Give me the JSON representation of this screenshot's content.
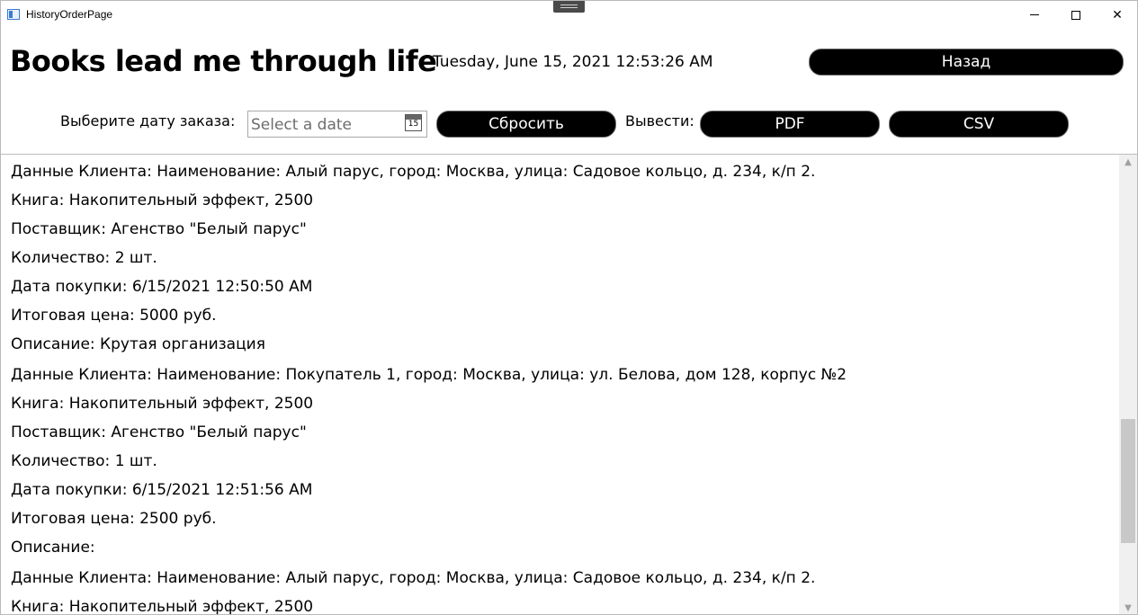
{
  "window": {
    "title": "HistoryOrderPage",
    "minimize_glyph": "",
    "close_glyph": "✕"
  },
  "header": {
    "brand": "Books lead me through life",
    "datetime": "Tuesday, June 15, 2021 12:53:26 AM",
    "back_label": "Назад"
  },
  "filter": {
    "date_label": "Выберите дату заказа:",
    "date_placeholder": "Select a date",
    "calendar_day": "15",
    "reset_label": "Сбросить",
    "export_label": "Вывести:",
    "pdf_label": "PDF",
    "csv_label": "CSV"
  },
  "orders": [
    {
      "client": "Данные Клиента: Наименование: Алый парус, город: Москва, улица: Садовое кольцо, д. 234, к/п 2.",
      "book": "Книга: Накопительный эффект, 2500",
      "supplier": "Поставщик: Агенство \"Белый парус\"",
      "quantity": "Количество: 2 шт.",
      "date": "Дата покупки: 6/15/2021 12:50:50 AM",
      "total": "Итоговая цена: 5000 руб.",
      "description": "Описание: Крутая организация"
    },
    {
      "client": "Данные Клиента: Наименование: Покупатель 1, город: Москва, улица: ул. Белова, дом 128, корпус №2",
      "book": "Книга: Накопительный эффект, 2500",
      "supplier": "Поставщик: Агенство \"Белый парус\"",
      "quantity": "Количество: 1 шт.",
      "date": "Дата покупки: 6/15/2021 12:51:56 AM",
      "total": "Итоговая цена: 2500 руб.",
      "description": "Описание:"
    },
    {
      "client": "Данные Клиента: Наименование: Алый парус, город: Москва, улица: Садовое кольцо, д. 234, к/п 2.",
      "book": "Книга: Накопительный эффект, 2500"
    }
  ],
  "scrollbar": {
    "up_glyph": "▲",
    "down_glyph": "▼",
    "position_fraction": 0.6
  }
}
